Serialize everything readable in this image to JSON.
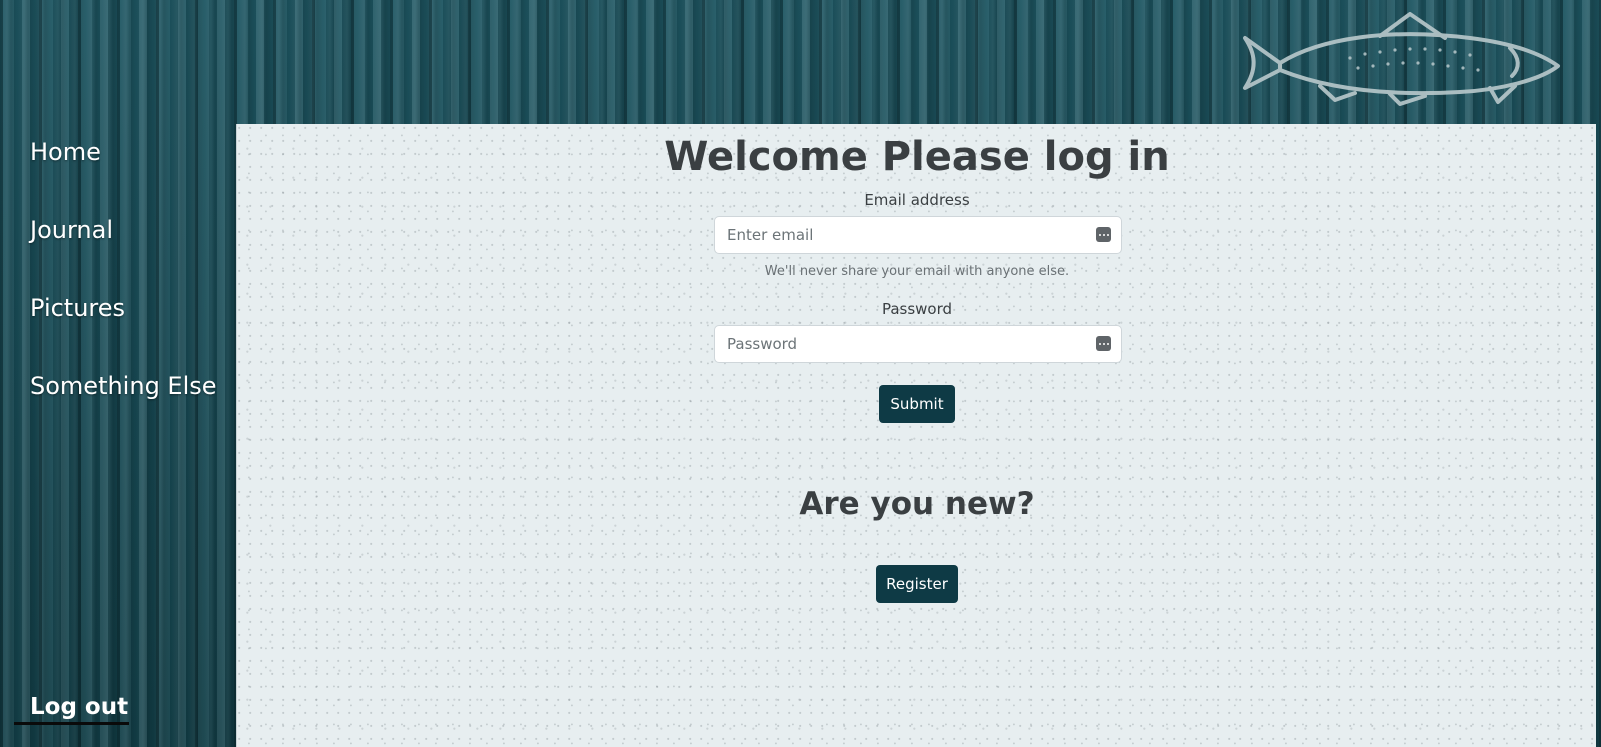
{
  "sidebar": {
    "items": [
      {
        "label": "Home"
      },
      {
        "label": "Journal"
      },
      {
        "label": "Pictures"
      },
      {
        "label": "Something Else"
      }
    ],
    "logout_label": "Log out"
  },
  "login": {
    "title": "Welcome Please log in",
    "email": {
      "label": "Email address",
      "placeholder": "Enter email",
      "value": "",
      "help": "We'll never share your email with anyone else."
    },
    "password": {
      "label": "Password",
      "placeholder": "Password",
      "value": ""
    },
    "submit_label": "Submit"
  },
  "register": {
    "title": "Are you new?",
    "button_label": "Register"
  },
  "icons": {
    "header_logo": "fish-icon",
    "email_field_icon": "password-manager-icon",
    "password_field_icon": "password-manager-icon"
  },
  "colors": {
    "accent": "#0e3a45",
    "sidebar_wood": "#17454f",
    "content_background": "#e7eef0"
  }
}
